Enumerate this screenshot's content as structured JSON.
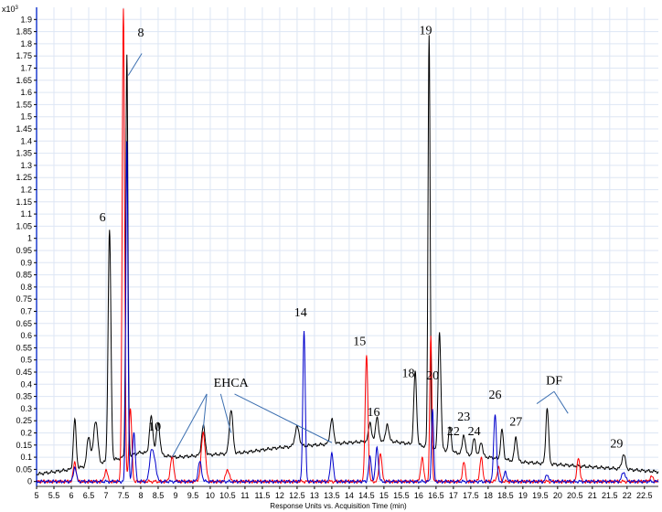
{
  "chart_data": {
    "type": "line",
    "title": "",
    "xlabel": "Response Units vs. Acquisition Time (min)",
    "ylabel": "",
    "y_multiplier": "x10",
    "y_multiplier_exp": "3",
    "xlim": [
      5,
      22.9
    ],
    "ylim": [
      -0.02,
      1.95
    ],
    "x_ticks": [
      "5",
      "5.5",
      "6",
      "6.5",
      "7",
      "7.5",
      "8",
      "8.5",
      "9",
      "9.5",
      "10",
      "10.5",
      "11",
      "11.5",
      "12",
      "12.5",
      "13",
      "13.5",
      "14",
      "14.5",
      "15",
      "15.5",
      "16",
      "16.5",
      "17",
      "17.5",
      "18",
      "18.5",
      "19",
      "19.5",
      "20",
      "20.5",
      "21",
      "21.5",
      "22",
      "22.5"
    ],
    "y_ticks": [
      "0",
      "0.05",
      "0.1",
      "0.15",
      "0.2",
      "0.25",
      "0.3",
      "0.35",
      "0.4",
      "0.45",
      "0.5",
      "0.55",
      "0.6",
      "0.65",
      "0.7",
      "0.75",
      "0.8",
      "0.85",
      "0.9",
      "0.95",
      "1",
      "1.05",
      "1.1",
      "1.15",
      "1.2",
      "1.25",
      "1.3",
      "1.35",
      "1.4",
      "1.45",
      "1.5",
      "1.55",
      "1.6",
      "1.65",
      "1.7",
      "1.75",
      "1.8",
      "1.85",
      "1.9"
    ],
    "grid": true,
    "series": [
      {
        "color": "#000000",
        "baseline": [
          [
            5,
            0.03
          ],
          [
            6,
            0.05
          ],
          [
            7,
            0.08
          ],
          [
            8,
            0.12
          ],
          [
            9,
            0.1
          ],
          [
            10,
            0.11
          ],
          [
            11,
            0.12
          ],
          [
            12,
            0.14
          ],
          [
            13,
            0.15
          ],
          [
            14,
            0.16
          ],
          [
            15,
            0.17
          ],
          [
            16,
            0.15
          ],
          [
            17,
            0.12
          ],
          [
            18,
            0.1
          ],
          [
            19,
            0.08
          ],
          [
            20,
            0.07
          ],
          [
            21,
            0.06
          ],
          [
            22,
            0.05
          ],
          [
            22.9,
            0.04
          ]
        ],
        "peaks": [
          [
            6.1,
            0.2,
            0.04
          ],
          [
            6.5,
            0.12,
            0.05
          ],
          [
            6.7,
            0.18,
            0.06
          ],
          [
            7.1,
            0.95,
            0.04
          ],
          [
            7.6,
            1.65,
            0.03
          ],
          [
            8.3,
            0.15,
            0.05
          ],
          [
            8.5,
            0.13,
            0.05
          ],
          [
            9.8,
            0.12,
            0.05
          ],
          [
            10.6,
            0.18,
            0.05
          ],
          [
            12.5,
            0.08,
            0.06
          ],
          [
            13.5,
            0.1,
            0.05
          ],
          [
            14.6,
            0.08,
            0.04
          ],
          [
            14.8,
            0.1,
            0.04
          ],
          [
            15.1,
            0.07,
            0.04
          ],
          [
            15.9,
            0.3,
            0.04
          ],
          [
            16.3,
            1.7,
            0.03
          ],
          [
            16.6,
            0.48,
            0.04
          ],
          [
            16.9,
            0.1,
            0.04
          ],
          [
            17.3,
            0.08,
            0.04
          ],
          [
            17.6,
            0.07,
            0.04
          ],
          [
            17.8,
            0.06,
            0.04
          ],
          [
            18.4,
            0.12,
            0.04
          ],
          [
            18.8,
            0.1,
            0.04
          ],
          [
            19.7,
            0.23,
            0.04
          ],
          [
            21.9,
            0.06,
            0.05
          ]
        ]
      },
      {
        "color": "#ff0000",
        "baseline": [
          [
            5,
            0.0
          ],
          [
            22.9,
            0.0
          ]
        ],
        "peaks": [
          [
            6.1,
            0.08,
            0.04
          ],
          [
            7.0,
            0.05,
            0.04
          ],
          [
            7.5,
            1.95,
            0.035
          ],
          [
            7.7,
            0.3,
            0.04
          ],
          [
            8.9,
            0.1,
            0.05
          ],
          [
            9.8,
            0.2,
            0.06
          ],
          [
            10.5,
            0.05,
            0.05
          ],
          [
            14.5,
            0.52,
            0.04
          ],
          [
            14.9,
            0.12,
            0.04
          ],
          [
            16.1,
            0.1,
            0.04
          ],
          [
            16.35,
            0.6,
            0.03
          ],
          [
            17.3,
            0.08,
            0.04
          ],
          [
            17.8,
            0.1,
            0.04
          ],
          [
            18.3,
            0.06,
            0.04
          ],
          [
            20.6,
            0.1,
            0.04
          ],
          [
            22.7,
            0.02,
            0.05
          ]
        ]
      },
      {
        "color": "#0000cc",
        "baseline": [
          [
            5,
            0.0
          ],
          [
            22.9,
            0.0
          ]
        ],
        "peaks": [
          [
            6.1,
            0.06,
            0.04
          ],
          [
            7.6,
            1.4,
            0.03
          ],
          [
            7.8,
            0.2,
            0.04
          ],
          [
            8.3,
            0.12,
            0.05
          ],
          [
            8.4,
            0.08,
            0.05
          ],
          [
            9.7,
            0.08,
            0.05
          ],
          [
            12.7,
            0.62,
            0.035
          ],
          [
            13.5,
            0.12,
            0.04
          ],
          [
            14.6,
            0.1,
            0.04
          ],
          [
            14.8,
            0.14,
            0.04
          ],
          [
            16.4,
            0.3,
            0.03
          ],
          [
            18.2,
            0.28,
            0.04
          ],
          [
            18.5,
            0.04,
            0.04
          ],
          [
            19.7,
            0.03,
            0.04
          ],
          [
            21.9,
            0.04,
            0.05
          ]
        ]
      }
    ],
    "annotations": [
      {
        "text": "8",
        "x": 8.0,
        "y": 1.83
      },
      {
        "text": "6",
        "x": 6.9,
        "y": 1.07
      },
      {
        "text": "10",
        "x": 8.4,
        "y": 0.21
      },
      {
        "text": "14",
        "x": 12.6,
        "y": 0.68
      },
      {
        "text": "15",
        "x": 14.3,
        "y": 0.56
      },
      {
        "text": "16",
        "x": 14.7,
        "y": 0.27
      },
      {
        "text": "18",
        "x": 15.7,
        "y": 0.43
      },
      {
        "text": "19",
        "x": 16.2,
        "y": 1.84
      },
      {
        "text": "20",
        "x": 16.4,
        "y": 0.42
      },
      {
        "text": "22",
        "x": 17.0,
        "y": 0.19
      },
      {
        "text": "23",
        "x": 17.3,
        "y": 0.25
      },
      {
        "text": "24",
        "x": 17.6,
        "y": 0.19
      },
      {
        "text": "26",
        "x": 18.2,
        "y": 0.34
      },
      {
        "text": "27",
        "x": 18.8,
        "y": 0.23
      },
      {
        "text": "29",
        "x": 21.7,
        "y": 0.14
      },
      {
        "text": "EHCA",
        "x": 10.6,
        "y": 0.39
      },
      {
        "text": "DF",
        "x": 19.9,
        "y": 0.4
      }
    ],
    "callouts": [
      {
        "from": [
          8.03,
          1.76
        ],
        "to": [
          7.64,
          1.67
        ]
      },
      {
        "from": [
          9.9,
          0.36
        ],
        "to": [
          8.9,
          0.1
        ]
      },
      {
        "from": [
          9.9,
          0.36
        ],
        "to": [
          9.8,
          0.22
        ]
      },
      {
        "from": [
          10.3,
          0.36
        ],
        "to": [
          10.6,
          0.2
        ]
      },
      {
        "from": [
          10.7,
          0.36
        ],
        "to": [
          13.5,
          0.16
        ]
      },
      {
        "from": [
          19.9,
          0.37
        ],
        "to": [
          19.4,
          0.32
        ]
      },
      {
        "from": [
          19.9,
          0.37
        ],
        "to": [
          20.3,
          0.28
        ]
      }
    ]
  }
}
